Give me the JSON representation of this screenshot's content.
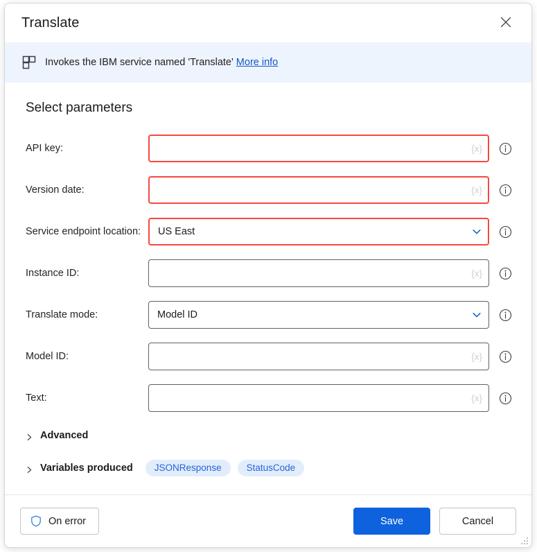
{
  "window": {
    "title": "Translate",
    "close_label": "Close",
    "close_icon": "close-icon"
  },
  "banner": {
    "icon": "service-blocks-icon",
    "text": "Invokes the IBM service named 'Translate'",
    "link_label": "More info",
    "background": "#eef4fd",
    "link_color": "#1158c7"
  },
  "main": {
    "section_title": "Select parameters",
    "variable_token": "{x}",
    "info_icon": "info-icon",
    "chevron_icon": "chevron-down-icon",
    "error_color": "#f6483f",
    "fields": [
      {
        "label": "API key:",
        "type": "text",
        "value": "",
        "placeholder": "",
        "error": true,
        "name": "api-key"
      },
      {
        "label": "Version date:",
        "type": "text",
        "value": "",
        "placeholder": "",
        "error": true,
        "name": "version-date"
      },
      {
        "label": "Service endpoint location:",
        "type": "select",
        "value": "US East",
        "error": true,
        "name": "service-endpoint-location"
      },
      {
        "label": "Instance ID:",
        "type": "text",
        "value": "",
        "placeholder": "",
        "error": false,
        "name": "instance-id"
      },
      {
        "label": "Translate mode:",
        "type": "select",
        "value": "Model ID",
        "error": false,
        "name": "translate-mode"
      },
      {
        "label": "Model ID:",
        "type": "text",
        "value": "",
        "placeholder": "",
        "error": false,
        "name": "model-id"
      },
      {
        "label": "Text:",
        "type": "text",
        "value": "",
        "placeholder": "",
        "error": false,
        "name": "text"
      }
    ],
    "expanders": [
      {
        "label": "Advanced",
        "name": "advanced",
        "pills": []
      },
      {
        "label": "Variables produced",
        "name": "variables-produced",
        "pills": [
          "JSONResponse",
          "StatusCode"
        ]
      }
    ]
  },
  "footer": {
    "on_error_label": "On error",
    "on_error_icon": "shield-icon",
    "save_label": "Save",
    "cancel_label": "Cancel",
    "primary_color": "#0f62de",
    "resize_grip": "resize-grip-icon"
  }
}
